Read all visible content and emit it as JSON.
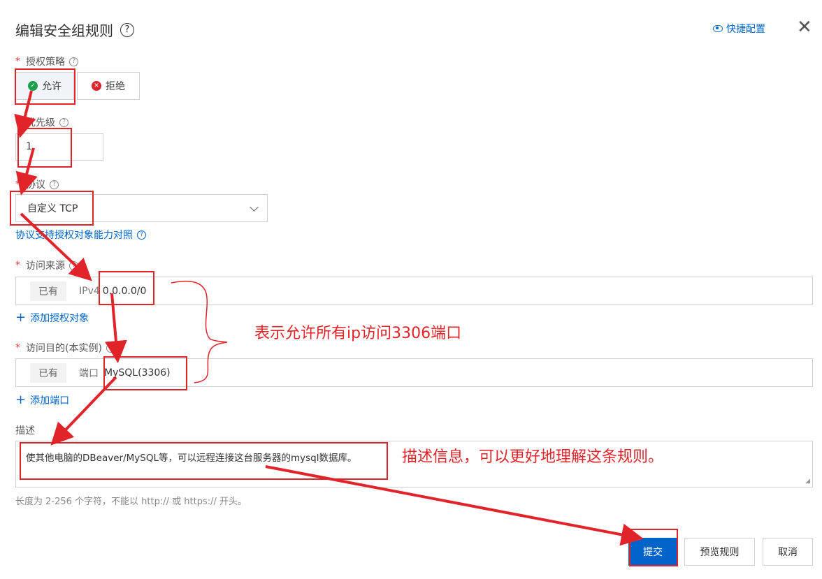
{
  "dialog": {
    "title": "编辑安全组规则",
    "title_help": "?",
    "quick_config": "快捷配置",
    "close_glyph": "✕"
  },
  "fields": {
    "policy": {
      "label": "授权策略",
      "options": [
        {
          "label": "允许",
          "selected": true,
          "icon": "check-circle-icon"
        },
        {
          "label": "拒绝",
          "selected": false,
          "icon": "x-circle-icon"
        }
      ]
    },
    "priority": {
      "label": "优先级",
      "value": "1"
    },
    "protocol": {
      "label": "协议",
      "value": "自定义 TCP",
      "help_link": "协议支持授权对象能力对照"
    },
    "source": {
      "label": "访问来源",
      "existing_tag": "已有",
      "type": "IPv4",
      "value": "0.0.0.0/0",
      "add_link": "添加授权对象"
    },
    "destination": {
      "label": "访问目的(本实例)",
      "existing_tag": "已有",
      "type": "端口",
      "value": "MySQL(3306)",
      "add_link": "添加端口"
    },
    "description": {
      "label": "描述",
      "value": "使其他电脑的DBeaver/MySQL等，可以远程连接这台服务器的mysql数据库。",
      "hint": "长度为 2-256 个字符，不能以 http:// 或 https:// 开头。"
    }
  },
  "footer": {
    "submit": "提交",
    "preview": "预览规则",
    "cancel": "取消"
  },
  "annotations": {
    "note_access": "表示允许所有ip访问3306端口",
    "note_desc": "描述信息，可以更好地理解这条规则。",
    "color": "#e0242a"
  },
  "colors": {
    "accent": "#0064c8",
    "required": "#e53935"
  }
}
